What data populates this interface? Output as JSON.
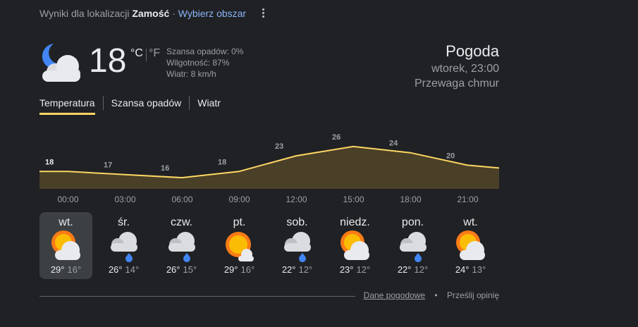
{
  "location": {
    "prefix": "Wyniki dla lokalizacji",
    "name": "Zamość",
    "separator": "·",
    "change_link": "Wybierz obszar"
  },
  "current": {
    "icon": "partly-cloudy-night-icon",
    "temperature": "18",
    "unit_c": "°C",
    "unit_f": "°F",
    "precip": "Szansa opadów: 0%",
    "humidity": "Wilgotność: 87%",
    "wind": "Wiatr: 8 km/h"
  },
  "header": {
    "title": "Pogoda",
    "datetime": "wtorek, 23:00",
    "condition": "Przewaga chmur"
  },
  "tabs": [
    "Temperatura",
    "Szansa opadów",
    "Wiatr"
  ],
  "chart_data": {
    "type": "area",
    "x": [
      "00:00",
      "03:00",
      "06:00",
      "09:00",
      "12:00",
      "15:00",
      "18:00",
      "21:00"
    ],
    "values": [
      18,
      17,
      16,
      18,
      23,
      26,
      24,
      20
    ],
    "series_color": "#fdd663",
    "fill_color": "#4a4028"
  },
  "forecast": [
    {
      "day": "wt.",
      "icon": "partly-sunny-icon",
      "hi": "29°",
      "lo": "16°"
    },
    {
      "day": "śr.",
      "icon": "rain-cloud-icon",
      "hi": "26°",
      "lo": "14°"
    },
    {
      "day": "czw.",
      "icon": "rain-cloud-icon",
      "hi": "26°",
      "lo": "15°"
    },
    {
      "day": "pt.",
      "icon": "mostly-sunny-icon",
      "hi": "29°",
      "lo": "16°"
    },
    {
      "day": "sob.",
      "icon": "rain-cloud-icon",
      "hi": "22°",
      "lo": "12°"
    },
    {
      "day": "niedz.",
      "icon": "partly-sunny-icon",
      "hi": "23°",
      "lo": "12°"
    },
    {
      "day": "pon.",
      "icon": "rain-cloud-icon",
      "hi": "22°",
      "lo": "12°"
    },
    {
      "day": "wt.",
      "icon": "partly-sunny-icon",
      "hi": "24°",
      "lo": "13°"
    }
  ],
  "footer": {
    "data_link": "Dane pogodowe",
    "dot": "•",
    "feedback": "Prześlij opinię"
  }
}
